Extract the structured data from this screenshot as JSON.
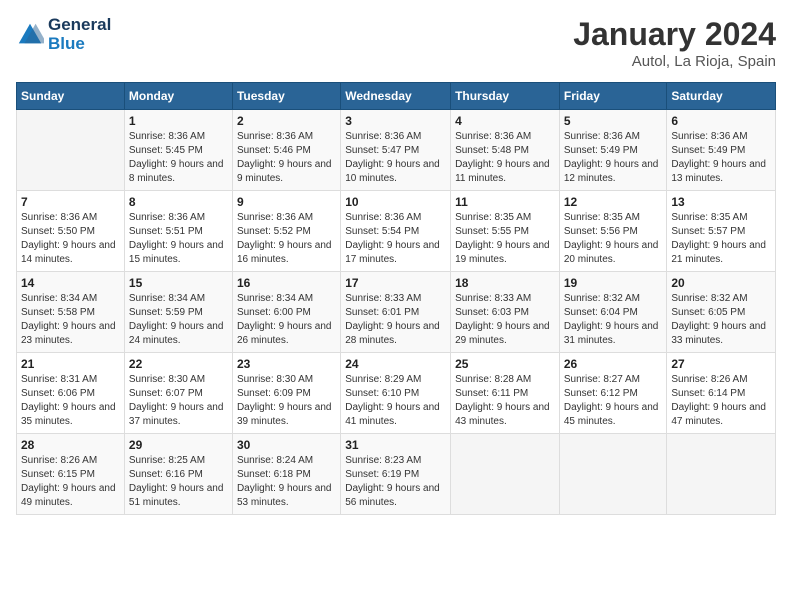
{
  "header": {
    "logo_line1": "General",
    "logo_line2": "Blue",
    "month_title": "January 2024",
    "location": "Autol, La Rioja, Spain"
  },
  "days_of_week": [
    "Sunday",
    "Monday",
    "Tuesday",
    "Wednesday",
    "Thursday",
    "Friday",
    "Saturday"
  ],
  "weeks": [
    [
      {
        "day": "",
        "sunrise": "",
        "sunset": "",
        "daylight": ""
      },
      {
        "day": "1",
        "sunrise": "Sunrise: 8:36 AM",
        "sunset": "Sunset: 5:45 PM",
        "daylight": "Daylight: 9 hours and 8 minutes."
      },
      {
        "day": "2",
        "sunrise": "Sunrise: 8:36 AM",
        "sunset": "Sunset: 5:46 PM",
        "daylight": "Daylight: 9 hours and 9 minutes."
      },
      {
        "day": "3",
        "sunrise": "Sunrise: 8:36 AM",
        "sunset": "Sunset: 5:47 PM",
        "daylight": "Daylight: 9 hours and 10 minutes."
      },
      {
        "day": "4",
        "sunrise": "Sunrise: 8:36 AM",
        "sunset": "Sunset: 5:48 PM",
        "daylight": "Daylight: 9 hours and 11 minutes."
      },
      {
        "day": "5",
        "sunrise": "Sunrise: 8:36 AM",
        "sunset": "Sunset: 5:49 PM",
        "daylight": "Daylight: 9 hours and 12 minutes."
      },
      {
        "day": "6",
        "sunrise": "Sunrise: 8:36 AM",
        "sunset": "Sunset: 5:49 PM",
        "daylight": "Daylight: 9 hours and 13 minutes."
      }
    ],
    [
      {
        "day": "7",
        "sunrise": "Sunrise: 8:36 AM",
        "sunset": "Sunset: 5:50 PM",
        "daylight": "Daylight: 9 hours and 14 minutes."
      },
      {
        "day": "8",
        "sunrise": "Sunrise: 8:36 AM",
        "sunset": "Sunset: 5:51 PM",
        "daylight": "Daylight: 9 hours and 15 minutes."
      },
      {
        "day": "9",
        "sunrise": "Sunrise: 8:36 AM",
        "sunset": "Sunset: 5:52 PM",
        "daylight": "Daylight: 9 hours and 16 minutes."
      },
      {
        "day": "10",
        "sunrise": "Sunrise: 8:36 AM",
        "sunset": "Sunset: 5:54 PM",
        "daylight": "Daylight: 9 hours and 17 minutes."
      },
      {
        "day": "11",
        "sunrise": "Sunrise: 8:35 AM",
        "sunset": "Sunset: 5:55 PM",
        "daylight": "Daylight: 9 hours and 19 minutes."
      },
      {
        "day": "12",
        "sunrise": "Sunrise: 8:35 AM",
        "sunset": "Sunset: 5:56 PM",
        "daylight": "Daylight: 9 hours and 20 minutes."
      },
      {
        "day": "13",
        "sunrise": "Sunrise: 8:35 AM",
        "sunset": "Sunset: 5:57 PM",
        "daylight": "Daylight: 9 hours and 21 minutes."
      }
    ],
    [
      {
        "day": "14",
        "sunrise": "Sunrise: 8:34 AM",
        "sunset": "Sunset: 5:58 PM",
        "daylight": "Daylight: 9 hours and 23 minutes."
      },
      {
        "day": "15",
        "sunrise": "Sunrise: 8:34 AM",
        "sunset": "Sunset: 5:59 PM",
        "daylight": "Daylight: 9 hours and 24 minutes."
      },
      {
        "day": "16",
        "sunrise": "Sunrise: 8:34 AM",
        "sunset": "Sunset: 6:00 PM",
        "daylight": "Daylight: 9 hours and 26 minutes."
      },
      {
        "day": "17",
        "sunrise": "Sunrise: 8:33 AM",
        "sunset": "Sunset: 6:01 PM",
        "daylight": "Daylight: 9 hours and 28 minutes."
      },
      {
        "day": "18",
        "sunrise": "Sunrise: 8:33 AM",
        "sunset": "Sunset: 6:03 PM",
        "daylight": "Daylight: 9 hours and 29 minutes."
      },
      {
        "day": "19",
        "sunrise": "Sunrise: 8:32 AM",
        "sunset": "Sunset: 6:04 PM",
        "daylight": "Daylight: 9 hours and 31 minutes."
      },
      {
        "day": "20",
        "sunrise": "Sunrise: 8:32 AM",
        "sunset": "Sunset: 6:05 PM",
        "daylight": "Daylight: 9 hours and 33 minutes."
      }
    ],
    [
      {
        "day": "21",
        "sunrise": "Sunrise: 8:31 AM",
        "sunset": "Sunset: 6:06 PM",
        "daylight": "Daylight: 9 hours and 35 minutes."
      },
      {
        "day": "22",
        "sunrise": "Sunrise: 8:30 AM",
        "sunset": "Sunset: 6:07 PM",
        "daylight": "Daylight: 9 hours and 37 minutes."
      },
      {
        "day": "23",
        "sunrise": "Sunrise: 8:30 AM",
        "sunset": "Sunset: 6:09 PM",
        "daylight": "Daylight: 9 hours and 39 minutes."
      },
      {
        "day": "24",
        "sunrise": "Sunrise: 8:29 AM",
        "sunset": "Sunset: 6:10 PM",
        "daylight": "Daylight: 9 hours and 41 minutes."
      },
      {
        "day": "25",
        "sunrise": "Sunrise: 8:28 AM",
        "sunset": "Sunset: 6:11 PM",
        "daylight": "Daylight: 9 hours and 43 minutes."
      },
      {
        "day": "26",
        "sunrise": "Sunrise: 8:27 AM",
        "sunset": "Sunset: 6:12 PM",
        "daylight": "Daylight: 9 hours and 45 minutes."
      },
      {
        "day": "27",
        "sunrise": "Sunrise: 8:26 AM",
        "sunset": "Sunset: 6:14 PM",
        "daylight": "Daylight: 9 hours and 47 minutes."
      }
    ],
    [
      {
        "day": "28",
        "sunrise": "Sunrise: 8:26 AM",
        "sunset": "Sunset: 6:15 PM",
        "daylight": "Daylight: 9 hours and 49 minutes."
      },
      {
        "day": "29",
        "sunrise": "Sunrise: 8:25 AM",
        "sunset": "Sunset: 6:16 PM",
        "daylight": "Daylight: 9 hours and 51 minutes."
      },
      {
        "day": "30",
        "sunrise": "Sunrise: 8:24 AM",
        "sunset": "Sunset: 6:18 PM",
        "daylight": "Daylight: 9 hours and 53 minutes."
      },
      {
        "day": "31",
        "sunrise": "Sunrise: 8:23 AM",
        "sunset": "Sunset: 6:19 PM",
        "daylight": "Daylight: 9 hours and 56 minutes."
      },
      {
        "day": "",
        "sunrise": "",
        "sunset": "",
        "daylight": ""
      },
      {
        "day": "",
        "sunrise": "",
        "sunset": "",
        "daylight": ""
      },
      {
        "day": "",
        "sunrise": "",
        "sunset": "",
        "daylight": ""
      }
    ]
  ]
}
